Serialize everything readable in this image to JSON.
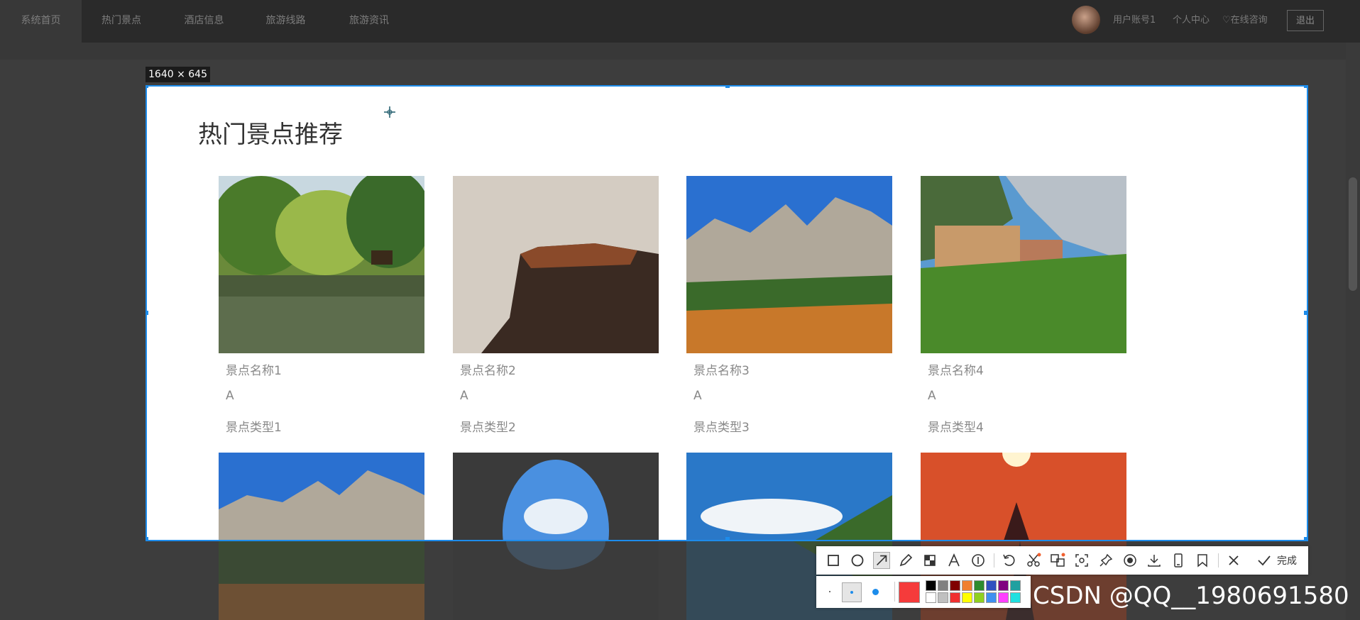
{
  "nav": {
    "items": [
      "系统首页",
      "热门景点",
      "酒店信息",
      "旅游线路",
      "旅游资讯"
    ],
    "user": "用户账号1",
    "profile": "个人中心",
    "consult": "在线咨询",
    "logout": "退出"
  },
  "capture": {
    "size_label": "1640 × 645"
  },
  "section": {
    "title": "热门景点推荐"
  },
  "cards": [
    {
      "name": "景点名称1",
      "letter": "A",
      "type": "景点类型1",
      "image": "lake-willow-photo"
    },
    {
      "name": "景点名称2",
      "letter": "A",
      "type": "景点类型2",
      "image": "cliff-photo"
    },
    {
      "name": "景点名称3",
      "letter": "A",
      "type": "景点类型3",
      "image": "mountain-photo"
    },
    {
      "name": "景点名称4",
      "letter": "A",
      "type": "景点类型4",
      "image": "village-photo"
    }
  ],
  "row2_images": [
    "mountain-photo",
    "cave-arch-photo",
    "valley-lake-photo",
    "sunset-photo"
  ],
  "toolbar": {
    "done_label": "完成",
    "icons": [
      "rectangle-icon",
      "ellipse-icon",
      "arrow-icon",
      "pencil-icon",
      "mosaic-icon",
      "text-icon",
      "number-icon",
      "undo-icon",
      "cut-icon",
      "translate-icon",
      "ocr-icon",
      "pin-icon",
      "record-icon",
      "download-icon",
      "phone-icon",
      "bookmark-icon",
      "close-icon",
      "check-icon"
    ],
    "active_color": "#f53b3b",
    "palette": [
      "#000000",
      "#808080",
      "#800000",
      "#f08030",
      "#2e8b2e",
      "#3050c0",
      "#800080",
      "#20a0a0",
      "#ffffff",
      "#c0c0c0",
      "#f03030",
      "#ffff00",
      "#90d020",
      "#4090f0",
      "#ff40ff",
      "#20e0e0"
    ]
  },
  "watermark": "CSDN @QQ__1980691580"
}
